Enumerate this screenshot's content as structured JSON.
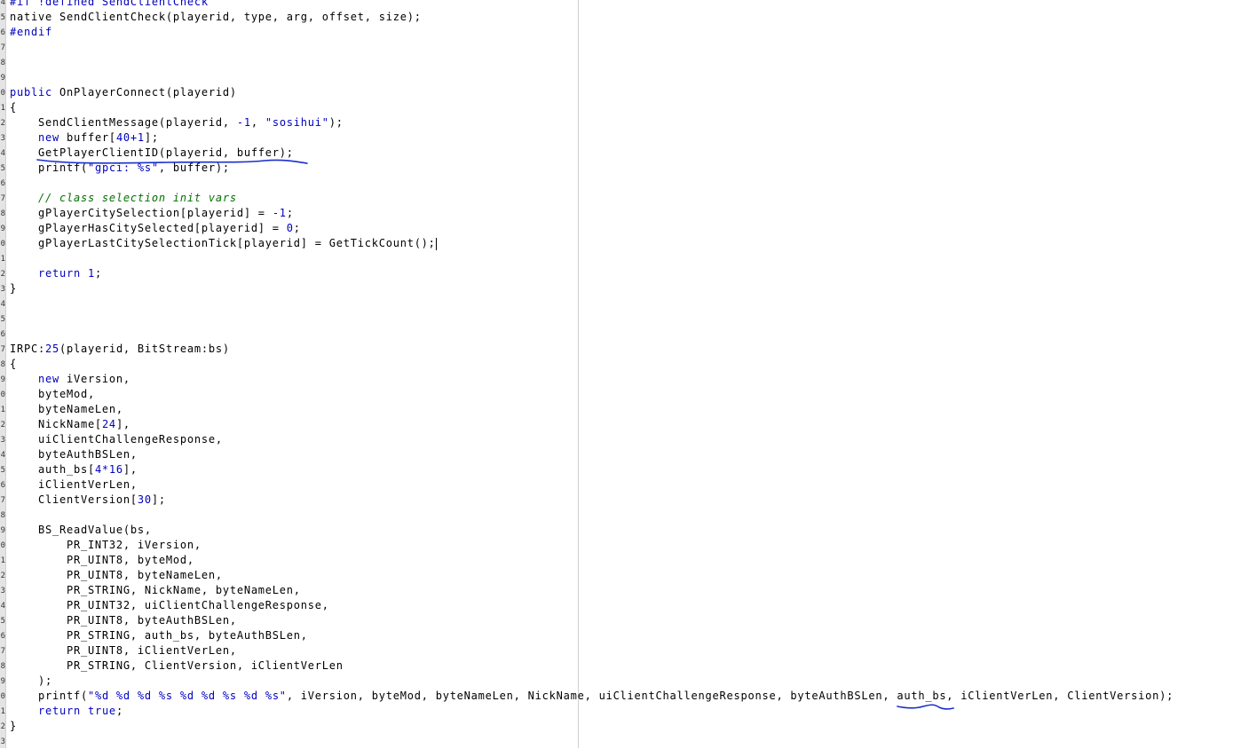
{
  "editor": {
    "line_numbers": [
      "4",
      "5",
      "6",
      "7",
      "8",
      "9",
      "0",
      "1",
      "2",
      "3",
      "4",
      "5",
      "6",
      "7",
      "8",
      "9",
      "0",
      "1",
      "2",
      "3",
      "4",
      "5",
      "6",
      "7",
      "8",
      "9",
      "0",
      "1",
      "2",
      "3",
      "4",
      "5",
      "6",
      "7",
      "8",
      "9",
      "0",
      "1",
      "2",
      "3",
      "4",
      "5",
      "6",
      "7",
      "8",
      "9",
      "0",
      "1",
      "2",
      "3"
    ],
    "lines": [
      [
        [
          "pp",
          "#if !defined SendClientCheck"
        ]
      ],
      [
        [
          "txt",
          "native SendClientCheck(playerid, type, arg, offset, size);"
        ]
      ],
      [
        [
          "pp",
          "#endif"
        ]
      ],
      [],
      [],
      [],
      [
        [
          "kw",
          "public"
        ],
        [
          "txt",
          " OnPlayerConnect(playerid)"
        ]
      ],
      [
        [
          "txt",
          "{"
        ]
      ],
      [
        [
          "txt",
          "    SendClientMessage(playerid, "
        ],
        [
          "num",
          "-1"
        ],
        [
          "txt",
          ", "
        ],
        [
          "str",
          "\"sosihui\""
        ],
        [
          "txt",
          ");"
        ]
      ],
      [
        [
          "txt",
          "    "
        ],
        [
          "kw",
          "new"
        ],
        [
          "txt",
          " buffer["
        ],
        [
          "num",
          "40+1"
        ],
        [
          "txt",
          "];"
        ]
      ],
      [
        [
          "txt",
          "    GetPlayerClientID(playerid, buffer);"
        ]
      ],
      [
        [
          "txt",
          "    printf("
        ],
        [
          "str",
          "\"gpci: %s\""
        ],
        [
          "txt",
          ", buffer);"
        ]
      ],
      [],
      [
        [
          "txt",
          "    "
        ],
        [
          "cmt",
          "// class selection init vars"
        ]
      ],
      [
        [
          "txt",
          "    gPlayerCitySelection[playerid] = "
        ],
        [
          "num",
          "-1"
        ],
        [
          "txt",
          ";"
        ]
      ],
      [
        [
          "txt",
          "    gPlayerHasCitySelected[playerid] = "
        ],
        [
          "num",
          "0"
        ],
        [
          "txt",
          ";"
        ]
      ],
      [
        [
          "txt",
          "    gPlayerLastCitySelectionTick[playerid] = GetTickCount();"
        ],
        [
          "caret",
          ""
        ]
      ],
      [],
      [
        [
          "txt",
          "    "
        ],
        [
          "kw",
          "return"
        ],
        [
          "txt",
          " "
        ],
        [
          "num",
          "1"
        ],
        [
          "txt",
          ";"
        ]
      ],
      [
        [
          "txt",
          "}"
        ]
      ],
      [],
      [],
      [],
      [
        [
          "txt",
          "IRPC:"
        ],
        [
          "num",
          "25"
        ],
        [
          "txt",
          "(playerid, BitStream:bs)"
        ]
      ],
      [
        [
          "txt",
          "{"
        ]
      ],
      [
        [
          "txt",
          "    "
        ],
        [
          "kw",
          "new"
        ],
        [
          "txt",
          " iVersion,"
        ]
      ],
      [
        [
          "txt",
          "    byteMod,"
        ]
      ],
      [
        [
          "txt",
          "    byteNameLen,"
        ]
      ],
      [
        [
          "txt",
          "    NickName["
        ],
        [
          "num",
          "24"
        ],
        [
          "txt",
          "],"
        ]
      ],
      [
        [
          "txt",
          "    uiClientChallengeResponse,"
        ]
      ],
      [
        [
          "txt",
          "    byteAuthBSLen,"
        ]
      ],
      [
        [
          "txt",
          "    auth_bs["
        ],
        [
          "num",
          "4*16"
        ],
        [
          "txt",
          "],"
        ]
      ],
      [
        [
          "txt",
          "    iClientVerLen,"
        ]
      ],
      [
        [
          "txt",
          "    ClientVersion["
        ],
        [
          "num",
          "30"
        ],
        [
          "txt",
          "];"
        ]
      ],
      [],
      [
        [
          "txt",
          "    BS_ReadValue(bs,"
        ]
      ],
      [
        [
          "txt",
          "        PR_INT32, iVersion,"
        ]
      ],
      [
        [
          "txt",
          "        PR_UINT8, byteMod,"
        ]
      ],
      [
        [
          "txt",
          "        PR_UINT8, byteNameLen,"
        ]
      ],
      [
        [
          "txt",
          "        PR_STRING, NickName, byteNameLen,"
        ]
      ],
      [
        [
          "txt",
          "        PR_UINT32, uiClientChallengeResponse,"
        ]
      ],
      [
        [
          "txt",
          "        PR_UINT8, byteAuthBSLen,"
        ]
      ],
      [
        [
          "txt",
          "        PR_STRING, auth_bs, byteAuthBSLen,"
        ]
      ],
      [
        [
          "txt",
          "        PR_UINT8, iClientVerLen,"
        ]
      ],
      [
        [
          "txt",
          "        PR_STRING, ClientVersion, iClientVerLen"
        ]
      ],
      [
        [
          "txt",
          "    );"
        ]
      ],
      [
        [
          "txt",
          "    printf("
        ],
        [
          "str",
          "\"%d %d %d %s %d %d %s %d %s\""
        ],
        [
          "txt",
          ", iVersion, byteMod, byteNameLen, NickName, uiClientChallengeResponse, byteAuthBSLen, auth_bs, iClientVerLen, ClientVersion);"
        ]
      ],
      [
        [
          "txt",
          "    "
        ],
        [
          "kw",
          "return"
        ],
        [
          "txt",
          " "
        ],
        [
          "kw",
          "true"
        ],
        [
          "txt",
          ";"
        ]
      ],
      [
        [
          "txt",
          "}"
        ]
      ],
      []
    ]
  },
  "annotations": [
    {
      "name": "underline-getplayerclientid",
      "color": "#1a2ecc"
    },
    {
      "name": "underline-auth-bs",
      "color": "#1a2ecc"
    }
  ]
}
